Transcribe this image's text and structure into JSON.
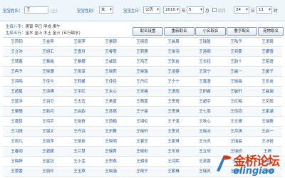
{
  "form": {
    "surname_label": "宝宝姓氏：",
    "surname_value": "王",
    "surname_hint": "(土)",
    "gender_label": "宝宝性别：",
    "gender_value": "女",
    "birth_label": "宝宝生日：",
    "calendar_value": "公历",
    "year_value": "2010",
    "year_unit": "年",
    "month_value": "5",
    "month_unit": "月",
    "leap_label": "闰月",
    "day_value": "24",
    "day_unit": "日",
    "hour_value": "11",
    "hour_unit": "时"
  },
  "info": {
    "bazi_label": "生辰八字：",
    "bazi_value": "庚寅 辛巳 甲戌 庚午",
    "wuxing_label": "生辰五行：",
    "wuxing_value": "金木 金火 木土 金火 (五行缺水)"
  },
  "buttons": [
    "取名设置",
    "重新取名",
    "小名取名",
    "叠字取名",
    "宠物取名"
  ],
  "names": [
    [
      "王莉钧",
      "王金宾",
      "王丽萍",
      "王紫钥",
      "王丽瑄",
      "王晨恩",
      "王瑞盈",
      "王陆予",
      "王语琦"
    ],
    [
      "王立沛",
      "王旭汇",
      "王雪月",
      "王睿莹",
      "王莉蓉",
      "王晓羽",
      "王洛熙",
      "王宛雾",
      "王娜雪"
    ],
    [
      "王琦嘉",
      "王紫霜",
      "王紫娜",
      "王咸琉",
      "王鸿艺",
      "王彰岩",
      "王长钰",
      "王韵十",
      "王昭语"
    ],
    [
      "王冉予",
      "王晓珊",
      "王雨淳",
      "王晓莉",
      "王晓瑞",
      "王凌雯",
      "王双宁",
      "王晨一",
      "王媛子"
    ],
    [
      "王鸿鸣",
      "王佳兮",
      "王莉媛",
      "王佳佳",
      "王丹红",
      "王宁宁",
      "王嘉澄",
      "王晓霖",
      "王冬岚"
    ],
    [
      "王超星",
      "王诗博",
      "王平红",
      "王永心",
      "王世格",
      "王语雨",
      "王研睿",
      "王敏轩",
      "王晨澜"
    ],
    [
      "王蓝洋",
      "王羽贝",
      "王太宜",
      "王美蓝",
      "王茜蓝",
      "王思琦",
      "王超宇",
      "王红梅",
      "王凤茹"
    ],
    [
      "王紫瞳",
      "王新月",
      "王启韵",
      "王苏燃",
      "王宁霏",
      "王思琪",
      "王七菲",
      "王佳钧",
      "王家涵"
    ],
    [
      "王嘉哲",
      "王鸿宇",
      "王晓奇",
      "王西楠",
      "王翊伦",
      "王子溪",
      "王秋心",
      "王文珊",
      "王瑞筱"
    ],
    [
      "王习晴",
      "王锦文",
      "王丹羽",
      "王乐舞",
      "王晓轩",
      "王思灵",
      "王晓冰",
      "王月琪",
      "王启一"
    ],
    [
      "王雨凡",
      "王丽萍",
      "王丽茹",
      "王晓明",
      "王蓉芝",
      "王家琪",
      "王元灵",
      "王瑞晨",
      "王冰锐"
    ],
    [
      "王春润",
      "王君媛",
      "王兰慧",
      "王瑞秀",
      "王晓彩",
      "王冬双",
      "王立欣",
      "王瑞欣",
      "王婷"
    ],
    [
      "王梅婷",
      "王星钰",
      "王小孟",
      "王思燕",
      "王骐泽",
      "王鸿熙",
      "王芙蓉",
      "王芹",
      "王晓兰"
    ],
    [
      "王蕾蕾",
      "王丽珍",
      "王玉燕",
      "王晓涵",
      "王晓宁",
      "王紫琳",
      "王瑞灵",
      "王瑞妍",
      "王丽媛"
    ]
  ],
  "watermark": {
    "text": "金桥论坛",
    "url": "elingiao",
    "icon": "flag-icon",
    "text_color": "#d23a16",
    "url_color": "#2a7cc7"
  },
  "colors": {
    "label": "#2a64a8",
    "name_link": "#1f56a0",
    "header_bg": "#eef5fb"
  }
}
